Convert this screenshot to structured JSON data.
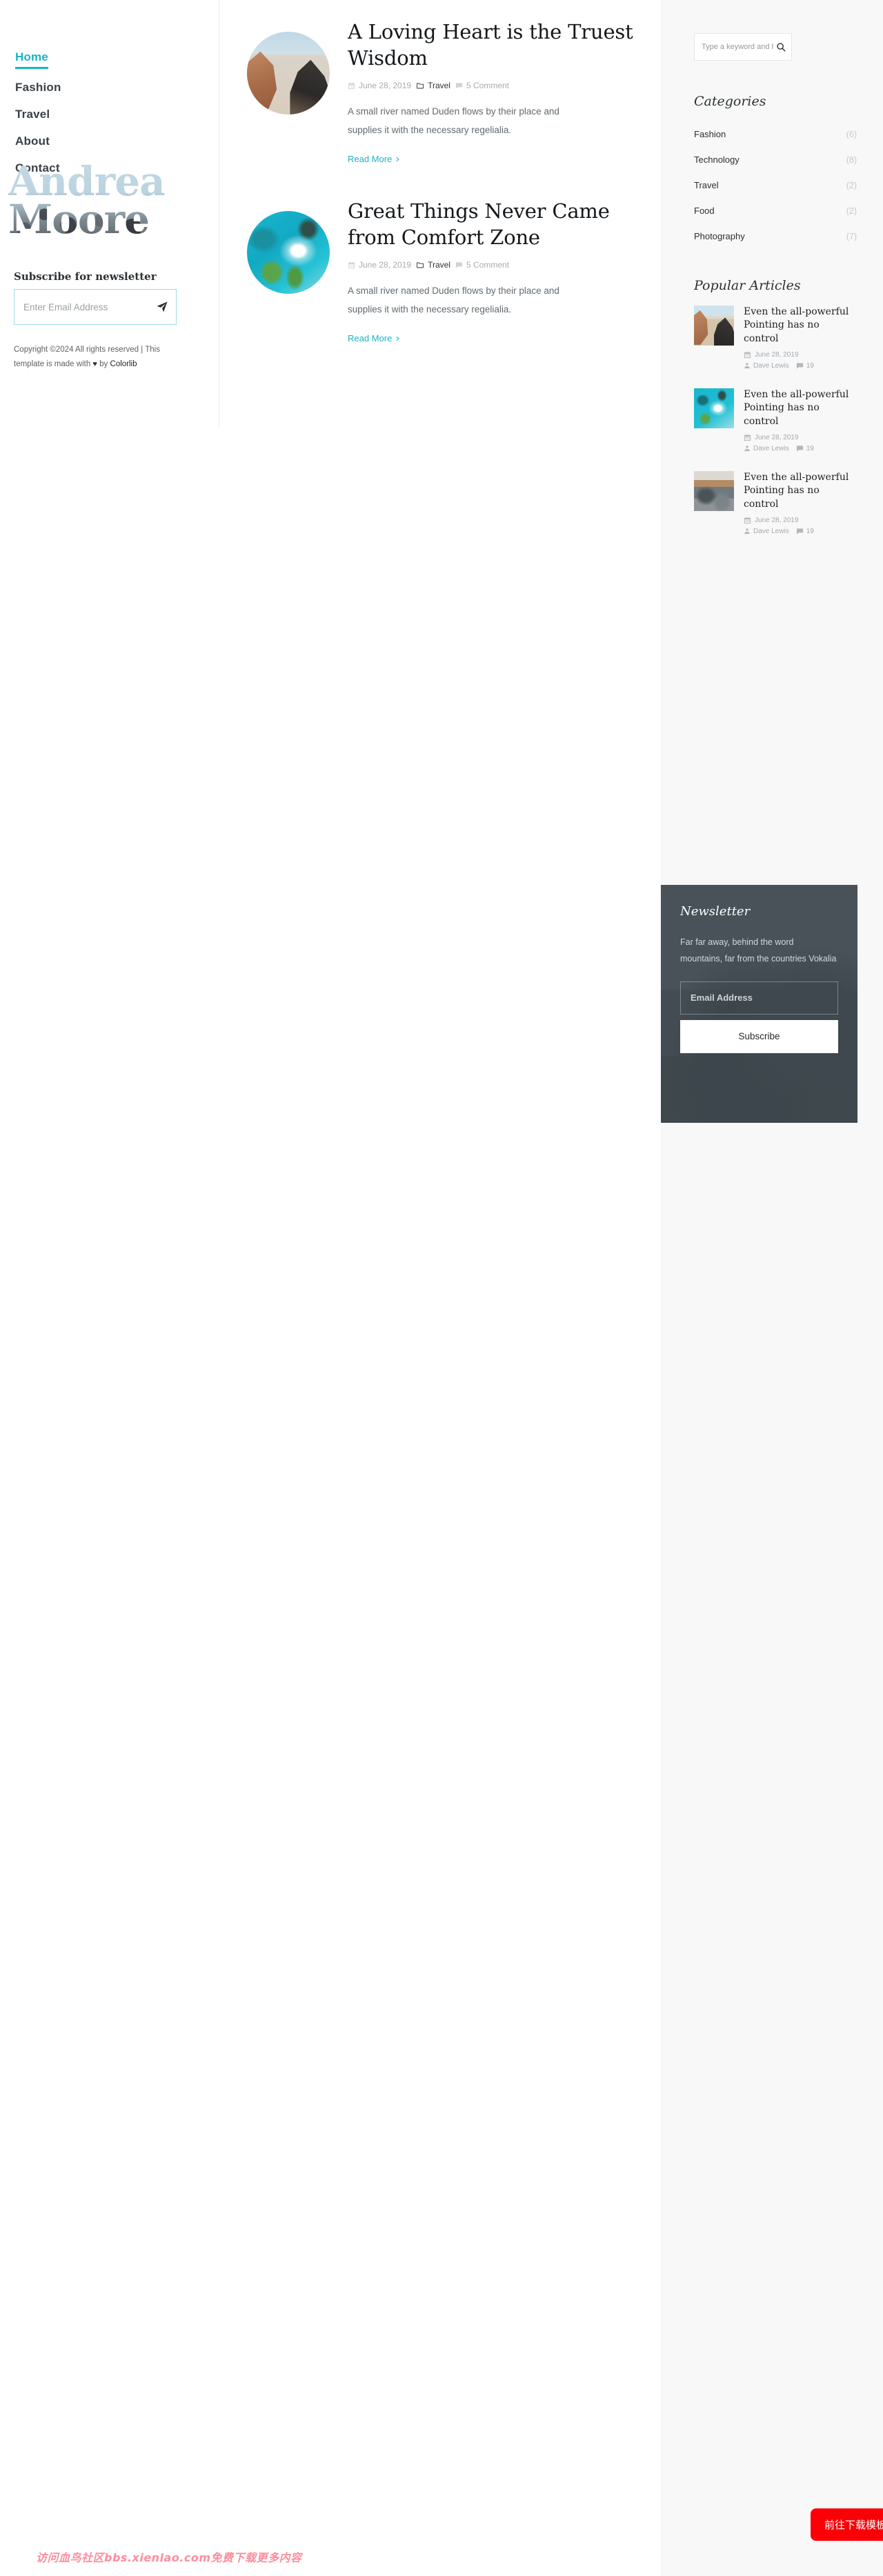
{
  "site": {
    "brand_line1": "Andrea",
    "brand_line2": "Moore"
  },
  "nav": {
    "items": [
      {
        "label": "Home",
        "active": true
      },
      {
        "label": "Fashion",
        "active": false
      },
      {
        "label": "Travel",
        "active": false
      },
      {
        "label": "About",
        "active": false
      },
      {
        "label": "Contact",
        "active": false
      }
    ]
  },
  "subscribe": {
    "title": "Subscribe for newsletter",
    "placeholder": "Enter Email Address",
    "send_icon": "paper-plane-icon"
  },
  "footer": {
    "copyright_line1": "Copyright ©2024 All rights reserved |",
    "copyright_line2": "This template is made with",
    "heart": "♥",
    "by": "by",
    "author": "Colorlib"
  },
  "posts": [
    {
      "title": "A Loving Heart is the Truest Wisdom",
      "date": "June 28, 2019",
      "category": "Travel",
      "comments": "5 Comment",
      "excerpt": "A small river named Duden flows by their place and supplies it with the necessary regelialia.",
      "read_more": "Read More",
      "thumb_class": "thumb-road"
    },
    {
      "title": "Great Things Never Came from Comfort Zone",
      "date": "June 28, 2019",
      "category": "Travel",
      "comments": "5 Comment",
      "excerpt": "A small river named Duden flows by their place and supplies it with the necessary regelialia.",
      "read_more": "Read More",
      "thumb_class": "thumb-ocean"
    }
  ],
  "search": {
    "placeholder": "Type a keyword and hi",
    "icon": "search-icon"
  },
  "categories": {
    "title": "Categories",
    "items": [
      {
        "name": "Fashion",
        "count": "(6)"
      },
      {
        "name": "Technology",
        "count": "(8)"
      },
      {
        "name": "Travel",
        "count": "(2)"
      },
      {
        "name": "Food",
        "count": "(2)"
      },
      {
        "name": "Photography",
        "count": "(7)"
      }
    ]
  },
  "popular": {
    "title": "Popular Articles",
    "items": [
      {
        "title": "Even the all-powerful Pointing has no control",
        "date": "June 28, 2019",
        "author": "Dave Lewis",
        "comments": "19",
        "thumb_class": "pt-road"
      },
      {
        "title": "Even the all-powerful Pointing has no control",
        "date": "June 28, 2019",
        "author": "Dave Lewis",
        "comments": "19",
        "thumb_class": "pt-ocean"
      },
      {
        "title": "Even the all-powerful Pointing has no control",
        "date": "June 28, 2019",
        "author": "Dave Lewis",
        "comments": "19",
        "thumb_class": "pt-coast"
      }
    ]
  },
  "newsletter": {
    "title": "Newsletter",
    "description": "Far far away, behind the word mountains, far from the countries Vokalia",
    "placeholder": "Email Address",
    "button": "Subscribe"
  },
  "overlay": {
    "watermark": "访问血鸟社区bbs.xienlao.com免费下载更多内容",
    "download_button": "前往下载模板"
  },
  "colors": {
    "accent": "#1ab4c6",
    "sidebar_bg": "#f8f8f8",
    "newsletter_bg": "#444e54",
    "download_red": "#fb0007",
    "watermark_pink": "#ff8d9c"
  }
}
